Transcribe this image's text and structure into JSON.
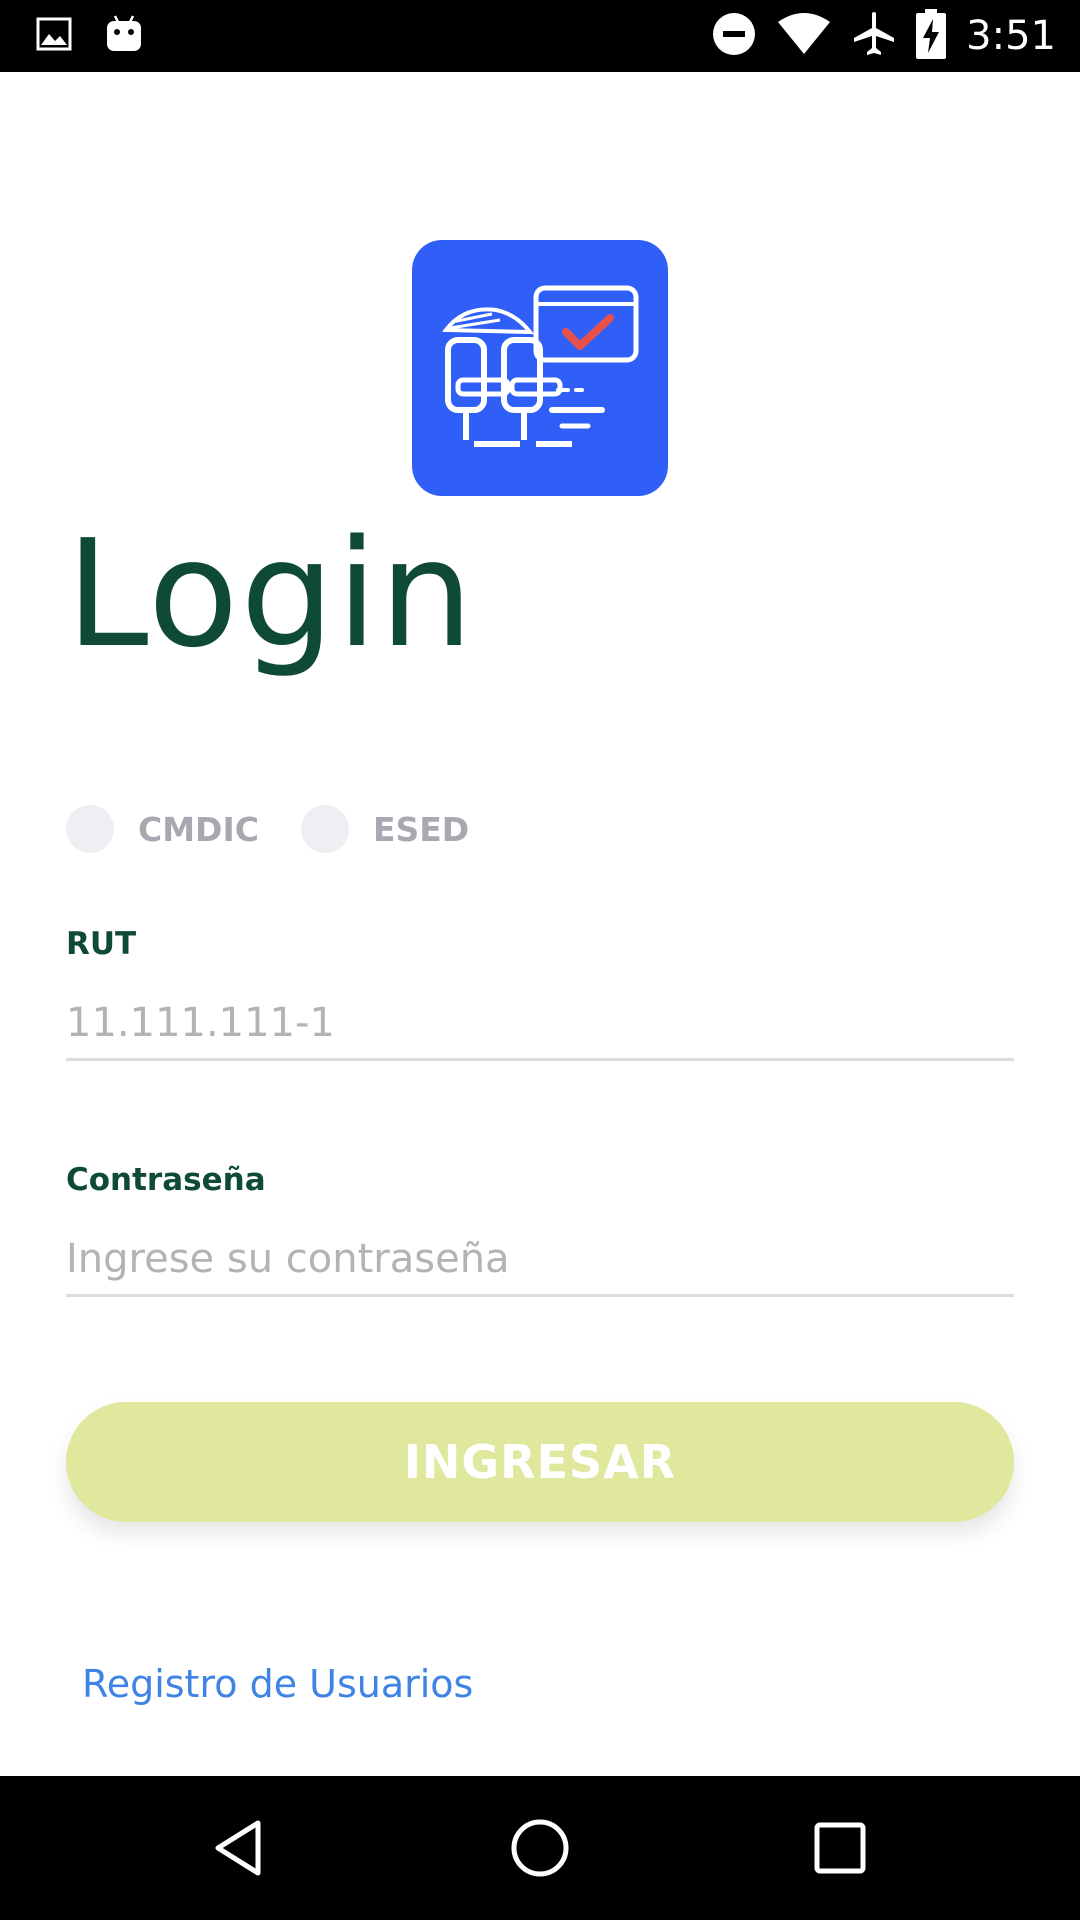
{
  "status_bar": {
    "time": "3:51",
    "icons": [
      "image-icon",
      "android-icon",
      "do-not-disturb-icon",
      "wifi-icon",
      "airplane-icon",
      "battery-charging-icon"
    ]
  },
  "logo": {
    "icon": "seat-booking-logo",
    "background_color": "#2f5ff6",
    "accent_color": "#e8514a"
  },
  "title": "Login",
  "company_options": [
    {
      "label": "CMDIC",
      "selected": false
    },
    {
      "label": "ESED",
      "selected": false
    }
  ],
  "rut_field": {
    "label": "RUT",
    "value": "",
    "placeholder": "11.111.111-1"
  },
  "password_field": {
    "label": "Contraseña",
    "value": "",
    "placeholder": "Ingrese su contraseña"
  },
  "submit_button": {
    "label": "INGRESAR",
    "color": "#dfe89c"
  },
  "register_link": "Registro de Usuarios",
  "colors": {
    "title": "#0f4a37",
    "link": "#3f84e5"
  },
  "nav_bar": {
    "icons": [
      "back-icon",
      "home-icon",
      "recents-icon"
    ]
  }
}
